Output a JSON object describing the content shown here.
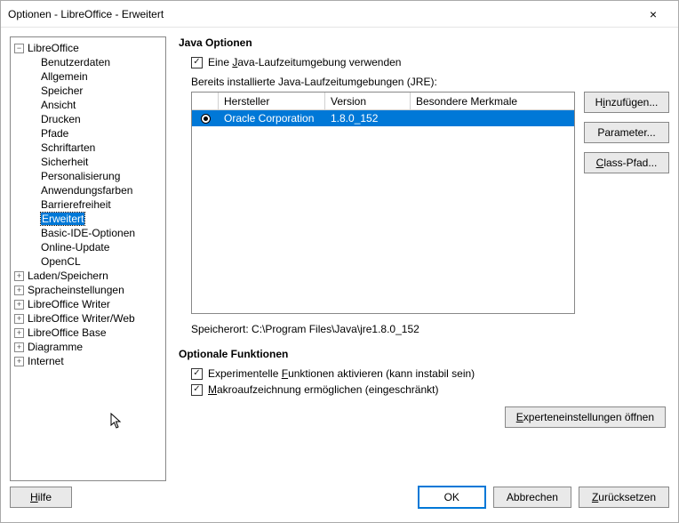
{
  "window": {
    "title": "Optionen - LibreOffice - Erweitert"
  },
  "tree": {
    "root": "LibreOffice",
    "children": [
      "Benutzerdaten",
      "Allgemein",
      "Speicher",
      "Ansicht",
      "Drucken",
      "Pfade",
      "Schriftarten",
      "Sicherheit",
      "Personalisierung",
      "Anwendungsfarben",
      "Barrierefreiheit",
      "Erweitert",
      "Basic-IDE-Optionen",
      "Online-Update",
      "OpenCL"
    ],
    "selected": "Erweitert",
    "siblings": [
      "Laden/Speichern",
      "Spracheinstellungen",
      "LibreOffice Writer",
      "LibreOffice Writer/Web",
      "LibreOffice Base",
      "Diagramme",
      "Internet"
    ]
  },
  "java": {
    "section": "Java Optionen",
    "use_jre_prefix": "Eine ",
    "use_jre_u": "J",
    "use_jre_suffix": "ava-Laufzeitumgebung verwenden",
    "installed_label": "Bereits installierte Java-Laufzeitumgebungen (JRE):",
    "cols": {
      "manu": "Hersteller",
      "ver": "Version",
      "feat": "Besondere Merkmale"
    },
    "row": {
      "manu": "Oracle Corporation",
      "ver": "1.8.0_152",
      "feat": ""
    },
    "btns": {
      "add_pre": "H",
      "add_u": "i",
      "add_post": "nzufügen...",
      "param": "Parameter...",
      "cp_pre": "",
      "cp_u": "C",
      "cp_post": "lass-Pfad..."
    },
    "loc_label": "Speicherort: ",
    "loc_value": "C:\\Program Files\\Java\\jre1.8.0_152"
  },
  "optional": {
    "section": "Optionale Funktionen",
    "exp_pre": "Experimentelle ",
    "exp_u": "F",
    "exp_post": "unktionen aktivieren (kann instabil sein)",
    "macro_pre": "",
    "macro_u": "M",
    "macro_post": "akroaufzeichnung ermöglichen (eingeschränkt)",
    "expert_pre": "",
    "expert_u": "E",
    "expert_post": "xperteneinstellungen öffnen"
  },
  "footer": {
    "help_pre": "",
    "help_u": "H",
    "help_post": "ilfe",
    "ok": "OK",
    "cancel": "Abbrechen",
    "reset_pre": "",
    "reset_u": "Z",
    "reset_post": "urücksetzen"
  }
}
